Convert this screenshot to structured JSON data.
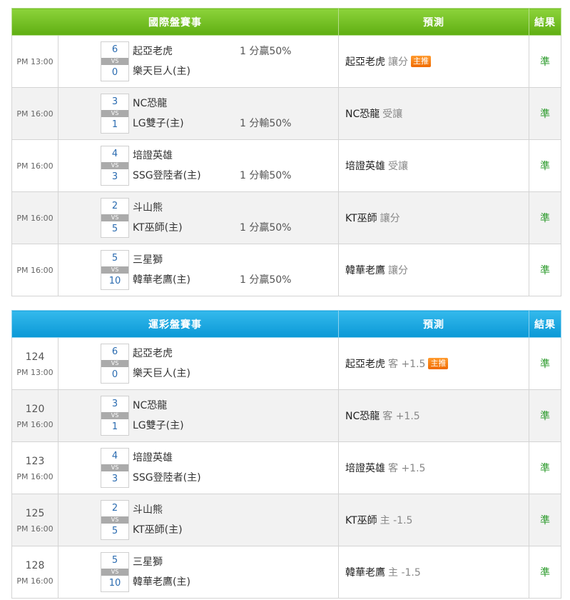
{
  "intl": {
    "header": {
      "event": "國際盤賽事",
      "prediction": "預測",
      "result": "結果"
    },
    "rows": [
      {
        "time": "PM 13:00",
        "away": "起亞老虎",
        "home": "樂天巨人(主)",
        "away_score": "6",
        "home_score": "0",
        "vs": "VS",
        "handicap_away": "1 分贏50%",
        "handicap_home": "",
        "pred_team": "起亞老虎",
        "pred_pick": "讓分",
        "badge": "主推",
        "result": "準"
      },
      {
        "time": "PM 16:00",
        "away": "NC恐龍",
        "home": "LG雙子(主)",
        "away_score": "3",
        "home_score": "1",
        "vs": "VS",
        "handicap_away": "",
        "handicap_home": "1 分輸50%",
        "pred_team": "NC恐龍",
        "pred_pick": "受讓",
        "badge": "",
        "result": "準"
      },
      {
        "time": "PM 16:00",
        "away": "培證英雄",
        "home": "SSG登陸者(主)",
        "away_score": "4",
        "home_score": "3",
        "vs": "VS",
        "handicap_away": "",
        "handicap_home": "1 分輸50%",
        "pred_team": "培證英雄",
        "pred_pick": "受讓",
        "badge": "",
        "result": "準"
      },
      {
        "time": "PM 16:00",
        "away": "斗山熊",
        "home": "KT巫師(主)",
        "away_score": "2",
        "home_score": "5",
        "vs": "VS",
        "handicap_away": "",
        "handicap_home": "1 分贏50%",
        "pred_team": "KT巫師",
        "pred_pick": "讓分",
        "badge": "",
        "result": "準"
      },
      {
        "time": "PM 16:00",
        "away": "三星獅",
        "home": "韓華老鷹(主)",
        "away_score": "5",
        "home_score": "10",
        "vs": "VS",
        "handicap_away": "",
        "handicap_home": "1 分贏50%",
        "pred_team": "韓華老鷹",
        "pred_pick": "讓分",
        "badge": "",
        "result": "準"
      }
    ]
  },
  "lottery": {
    "header": {
      "event": "運彩盤賽事",
      "prediction": "預測",
      "result": "結果"
    },
    "rows": [
      {
        "code": "124",
        "time": "PM 13:00",
        "away": "起亞老虎",
        "home": "樂天巨人(主)",
        "away_score": "6",
        "home_score": "0",
        "vs": "VS",
        "pred_team": "起亞老虎",
        "pred_pick": "客 +1.5",
        "badge": "主推",
        "result": "準"
      },
      {
        "code": "120",
        "time": "PM 16:00",
        "away": "NC恐龍",
        "home": "LG雙子(主)",
        "away_score": "3",
        "home_score": "1",
        "vs": "VS",
        "pred_team": "NC恐龍",
        "pred_pick": "客 +1.5",
        "badge": "",
        "result": "準"
      },
      {
        "code": "123",
        "time": "PM 16:00",
        "away": "培證英雄",
        "home": "SSG登陸者(主)",
        "away_score": "4",
        "home_score": "3",
        "vs": "VS",
        "pred_team": "培證英雄",
        "pred_pick": "客 +1.5",
        "badge": "",
        "result": "準"
      },
      {
        "code": "125",
        "time": "PM 16:00",
        "away": "斗山熊",
        "home": "KT巫師(主)",
        "away_score": "2",
        "home_score": "5",
        "vs": "VS",
        "pred_team": "KT巫師",
        "pred_pick": "主 -1.5",
        "badge": "",
        "result": "準"
      },
      {
        "code": "128",
        "time": "PM 16:00",
        "away": "三星獅",
        "home": "韓華老鷹(主)",
        "away_score": "5",
        "home_score": "10",
        "vs": "VS",
        "pred_team": "韓華老鷹",
        "pred_pick": "主 -1.5",
        "badge": "",
        "result": "準"
      }
    ]
  },
  "colors": {
    "intl_header": "#6ebf1f",
    "lottery_header": "#1fa7e1",
    "score": "#2a6bb0",
    "result": "#2a9a2a",
    "badge": "#f37d10"
  }
}
